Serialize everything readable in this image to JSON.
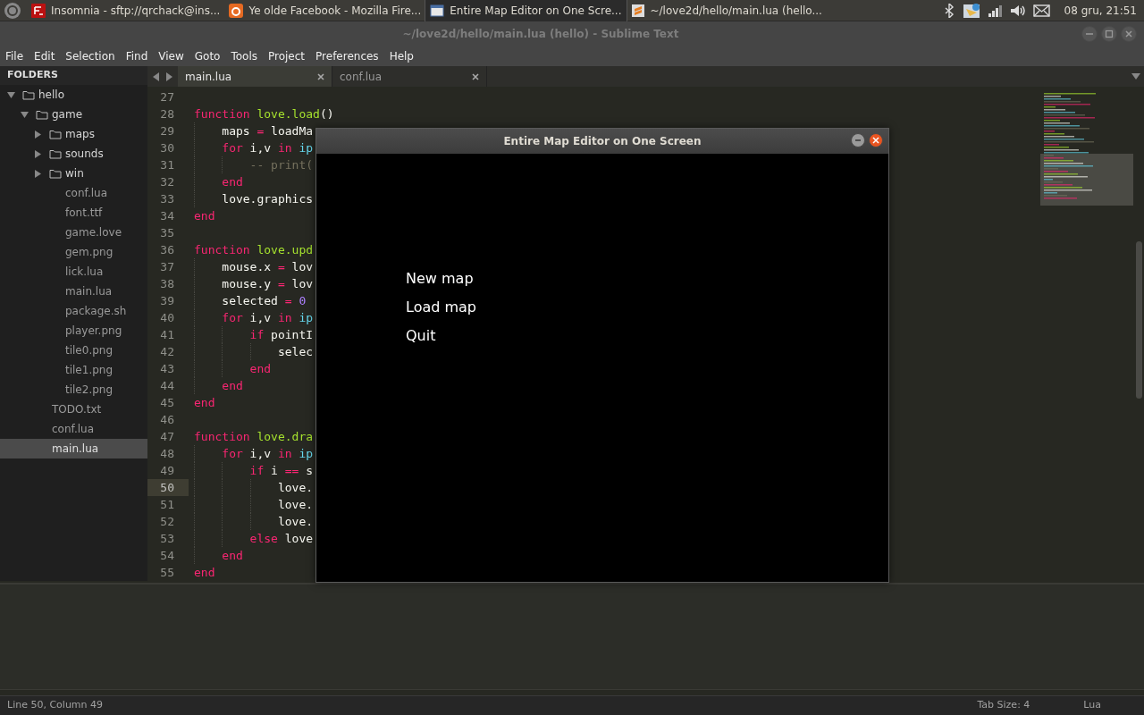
{
  "taskbar": {
    "items": [
      {
        "label": "Insomnia - sftp://qrchack@ins...",
        "selected": false
      },
      {
        "label": "Ye olde Facebook - Mozilla Fire...",
        "selected": false
      },
      {
        "label": "Entire Map Editor on One Scre...",
        "selected": true
      },
      {
        "label": "~/love2d/hello/main.lua (hello...",
        "selected": false
      }
    ],
    "clock": "08 gru, 21:51"
  },
  "window": {
    "title": "~/love2d/hello/main.lua (hello) - Sublime Text"
  },
  "menu": [
    "File",
    "Edit",
    "Selection",
    "Find",
    "View",
    "Goto",
    "Tools",
    "Project",
    "Preferences",
    "Help"
  ],
  "sidebar": {
    "header": "FOLDERS",
    "items": [
      {
        "label": "hello",
        "kind": "folder",
        "expanded": true,
        "selected": false,
        "children": [
          {
            "label": "game",
            "kind": "folder",
            "expanded": true,
            "selected": false,
            "children": [
              {
                "label": "maps",
                "kind": "folder",
                "expanded": false,
                "selected": false
              },
              {
                "label": "sounds",
                "kind": "folder",
                "expanded": false,
                "selected": false
              },
              {
                "label": "win",
                "kind": "folder",
                "expanded": false,
                "selected": false
              },
              {
                "label": "conf.lua",
                "kind": "file",
                "selected": false
              },
              {
                "label": "font.ttf",
                "kind": "file",
                "selected": false
              },
              {
                "label": "game.love",
                "kind": "file",
                "selected": false
              },
              {
                "label": "gem.png",
                "kind": "file",
                "selected": false
              },
              {
                "label": "lick.lua",
                "kind": "file",
                "selected": false
              },
              {
                "label": "main.lua",
                "kind": "file",
                "selected": false
              },
              {
                "label": "package.sh",
                "kind": "file",
                "selected": false
              },
              {
                "label": "player.png",
                "kind": "file",
                "selected": false
              },
              {
                "label": "tile0.png",
                "kind": "file",
                "selected": false
              },
              {
                "label": "tile1.png",
                "kind": "file",
                "selected": false
              },
              {
                "label": "tile2.png",
                "kind": "file",
                "selected": false
              }
            ]
          },
          {
            "label": "TODO.txt",
            "kind": "file",
            "selected": false
          },
          {
            "label": "conf.lua",
            "kind": "file",
            "selected": false
          },
          {
            "label": "main.lua",
            "kind": "file",
            "selected": true
          }
        ]
      }
    ]
  },
  "tabs": [
    {
      "label": "main.lua",
      "selected": true
    },
    {
      "label": "conf.lua",
      "selected": false
    }
  ],
  "code": [
    {
      "number": "27",
      "current": false
    },
    {
      "number": "28",
      "current": false,
      "tokens": [
        {
          "kind": "keyword",
          "text": "function "
        },
        {
          "kind": "function",
          "text": "love.load"
        },
        {
          "kind": "plain",
          "text": "()"
        }
      ]
    },
    {
      "number": "29",
      "current": false,
      "tokens": [
        {
          "kind": "plain",
          "text": "    maps "
        },
        {
          "kind": "keyword",
          "text": "="
        },
        {
          "kind": "plain",
          "text": " loadMa"
        }
      ]
    },
    {
      "number": "30",
      "current": false,
      "tokens": [
        {
          "kind": "keyword",
          "text": "    for"
        },
        {
          "kind": "plain",
          "text": " i,v "
        },
        {
          "kind": "keyword",
          "text": "in"
        },
        {
          "kind": "builtin",
          "text": " ip"
        }
      ]
    },
    {
      "number": "31",
      "current": false,
      "tokens": [
        {
          "kind": "comment",
          "text": "        -- print("
        }
      ]
    },
    {
      "number": "32",
      "current": false,
      "tokens": [
        {
          "kind": "keyword",
          "text": "    end"
        }
      ]
    },
    {
      "number": "33",
      "current": false,
      "tokens": [
        {
          "kind": "plain",
          "text": "    love.graphics"
        }
      ]
    },
    {
      "number": "34",
      "current": false,
      "tokens": [
        {
          "kind": "keyword",
          "text": "end"
        }
      ]
    },
    {
      "number": "35",
      "current": false
    },
    {
      "number": "36",
      "current": false,
      "tokens": [
        {
          "kind": "keyword",
          "text": "function "
        },
        {
          "kind": "function",
          "text": "love.upd"
        }
      ]
    },
    {
      "number": "37",
      "current": false,
      "tokens": [
        {
          "kind": "plain",
          "text": "    mouse.x "
        },
        {
          "kind": "keyword",
          "text": "="
        },
        {
          "kind": "plain",
          "text": " lov"
        }
      ]
    },
    {
      "number": "38",
      "current": false,
      "tokens": [
        {
          "kind": "plain",
          "text": "    mouse.y "
        },
        {
          "kind": "keyword",
          "text": "="
        },
        {
          "kind": "plain",
          "text": " lov"
        }
      ]
    },
    {
      "number": "39",
      "current": false,
      "tokens": [
        {
          "kind": "plain",
          "text": "    selected "
        },
        {
          "kind": "keyword",
          "text": "="
        },
        {
          "kind": "number",
          "text": " 0"
        }
      ]
    },
    {
      "number": "40",
      "current": false,
      "tokens": [
        {
          "kind": "keyword",
          "text": "    for"
        },
        {
          "kind": "plain",
          "text": " i,v "
        },
        {
          "kind": "keyword",
          "text": "in"
        },
        {
          "kind": "builtin",
          "text": " ip"
        }
      ]
    },
    {
      "number": "41",
      "current": false,
      "tokens": [
        {
          "kind": "keyword",
          "text": "        if"
        },
        {
          "kind": "plain",
          "text": " pointI"
        }
      ]
    },
    {
      "number": "42",
      "current": false,
      "tokens": [
        {
          "kind": "plain",
          "text": "            selec"
        }
      ]
    },
    {
      "number": "43",
      "current": false,
      "tokens": [
        {
          "kind": "keyword",
          "text": "        end"
        }
      ]
    },
    {
      "number": "44",
      "current": false,
      "tokens": [
        {
          "kind": "keyword",
          "text": "    end"
        }
      ]
    },
    {
      "number": "45",
      "current": false,
      "tokens": [
        {
          "kind": "keyword",
          "text": "end"
        }
      ]
    },
    {
      "number": "46",
      "current": false
    },
    {
      "number": "47",
      "current": false,
      "tokens": [
        {
          "kind": "keyword",
          "text": "function "
        },
        {
          "kind": "function",
          "text": "love.dra"
        }
      ]
    },
    {
      "number": "48",
      "current": false,
      "tokens": [
        {
          "kind": "keyword",
          "text": "    for"
        },
        {
          "kind": "plain",
          "text": " i,v "
        },
        {
          "kind": "keyword",
          "text": "in"
        },
        {
          "kind": "builtin",
          "text": " ip"
        }
      ]
    },
    {
      "number": "49",
      "current": false,
      "tokens": [
        {
          "kind": "keyword",
          "text": "        if"
        },
        {
          "kind": "plain",
          "text": " i "
        },
        {
          "kind": "keyword",
          "text": "=="
        },
        {
          "kind": "plain",
          "text": " s"
        }
      ]
    },
    {
      "number": "50",
      "current": true,
      "tokens": [
        {
          "kind": "plain",
          "text": "            love."
        }
      ]
    },
    {
      "number": "51",
      "current": false,
      "tokens": [
        {
          "kind": "plain",
          "text": "            love."
        }
      ]
    },
    {
      "number": "52",
      "current": false,
      "tokens": [
        {
          "kind": "plain",
          "text": "            love."
        }
      ]
    },
    {
      "number": "53",
      "current": false,
      "tokens": [
        {
          "kind": "keyword",
          "text": "        else"
        },
        {
          "kind": "plain",
          "text": " love"
        }
      ]
    },
    {
      "number": "54",
      "current": false,
      "tokens": [
        {
          "kind": "keyword",
          "text": "    end"
        }
      ]
    },
    {
      "number": "55",
      "current": false,
      "tokens": [
        {
          "kind": "keyword",
          "text": "end"
        }
      ]
    }
  ],
  "game_window": {
    "title": "Entire Map Editor on One Screen",
    "menu": [
      "New map",
      "Load map",
      "Quit"
    ]
  },
  "status_bar": {
    "position": "Line 50, Column 49",
    "tab_size": "Tab Size: 4",
    "syntax": "Lua"
  }
}
